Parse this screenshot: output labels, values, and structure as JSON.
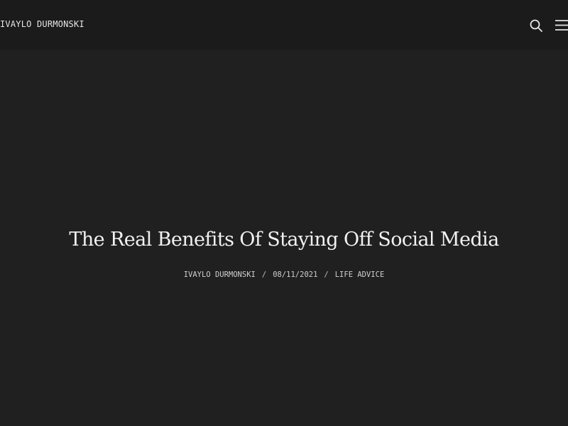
{
  "header": {
    "site_title": "IVAYLO DURMONSKI",
    "icons": {
      "search": "search-icon",
      "menu": "hamburger-menu-icon"
    }
  },
  "post": {
    "title": "The Real Benefits Of Staying Off Social Media",
    "author": "IVAYLO DURMONSKI",
    "date": "08/11/2021",
    "category": "LIFE ADVICE",
    "separator": "/"
  },
  "colors": {
    "header_background": "#1b1b1b",
    "page_background": "#202020",
    "text": "#f2f2f2"
  }
}
